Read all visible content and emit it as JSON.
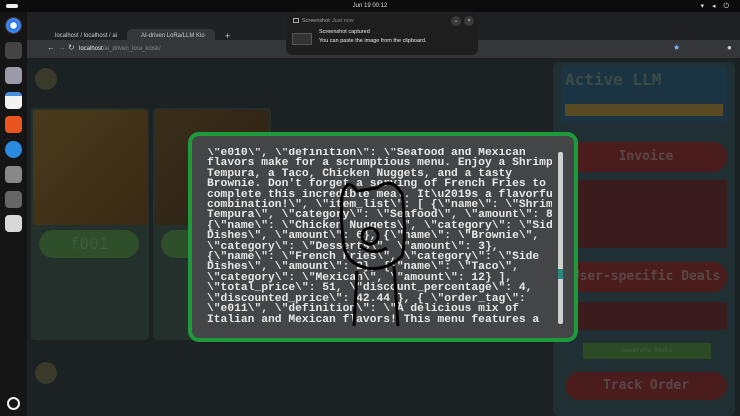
{
  "system": {
    "clock": "Jun 19  00:12",
    "tray": "▾ ◂ ⏻"
  },
  "browser": {
    "tabs": [
      {
        "label": "localhost / localhost / ai"
      },
      {
        "label": "AI-driven LoRa/LLM Kio"
      }
    ],
    "new_tab": "+",
    "url_host": "localhost",
    "url_path": "/ai_driven_lora_kiosk/"
  },
  "notification": {
    "app": "Screenshot",
    "time": "Just now",
    "title": "Screenshot captured",
    "body": "You can paste the image from the clipboard."
  },
  "background": {
    "cards": [
      {
        "label": "f001"
      },
      {
        "label": ""
      }
    ],
    "right_panel": {
      "active_llm_title": "Active LLM",
      "invoice_button": "Invoice",
      "deals_button": "User-specific Deals",
      "generate_button": "Generate Deals",
      "track_button": "Track Order"
    }
  },
  "modal": {
    "lines": [
      "\\\"e010\\\", \\\"definition\\\": \\\"Seafood and Mexican",
      "flavors make for a scrumptious menu. Enjoy a Shrimp",
      "Tempura, a Taco, Chicken Nuggets, and a tasty",
      "Brownie. Don't forget a serving of French Fries to",
      "complete this incredible meal. It\\u2019s a flavorful",
      "combination!\\\", \\\"item_list\\\": [ {\\\"name\\\": \\\"Shrimp",
      "Tempura\\\", \\\"category\\\": \\\"Seafood\\\", \\\"amount\\\": 8},",
      "{\\\"name\\\": \\\"Chicken Nuggets\\\", \\\"category\\\": \\\"Side",
      "Dishes\\\", \\\"amount\\\": 6}, {\\\"name\\\": \\\"Brownie\\\",",
      "\\\"category\\\": \\\"Desserts\\\", \\\"amount\\\": 3},",
      "{\\\"name\\\": \\\"French Fries\\\", \\\"category\\\": \\\"Side",
      "Dishes\\\", \\\"amount\\\": 2}, {\\\"name\\\": \\\"Taco\\\",",
      "\\\"category\\\": \\\"Mexican\\\", \\\"amount\\\": 12} ],",
      "\\\"total_price\\\": 51, \\\"discount_percentage\\\": 4,",
      "\\\"discounted_price\\\": 42.44 }, { \\\"order_tag\\\":",
      "\\\"e011\\\", \\\"definition\\\": \\\"A delicious mix of",
      "Italian and Mexican flavors! This menu features a"
    ],
    "scroll_position": 0.72,
    "border_color": "#1f9a3a"
  }
}
